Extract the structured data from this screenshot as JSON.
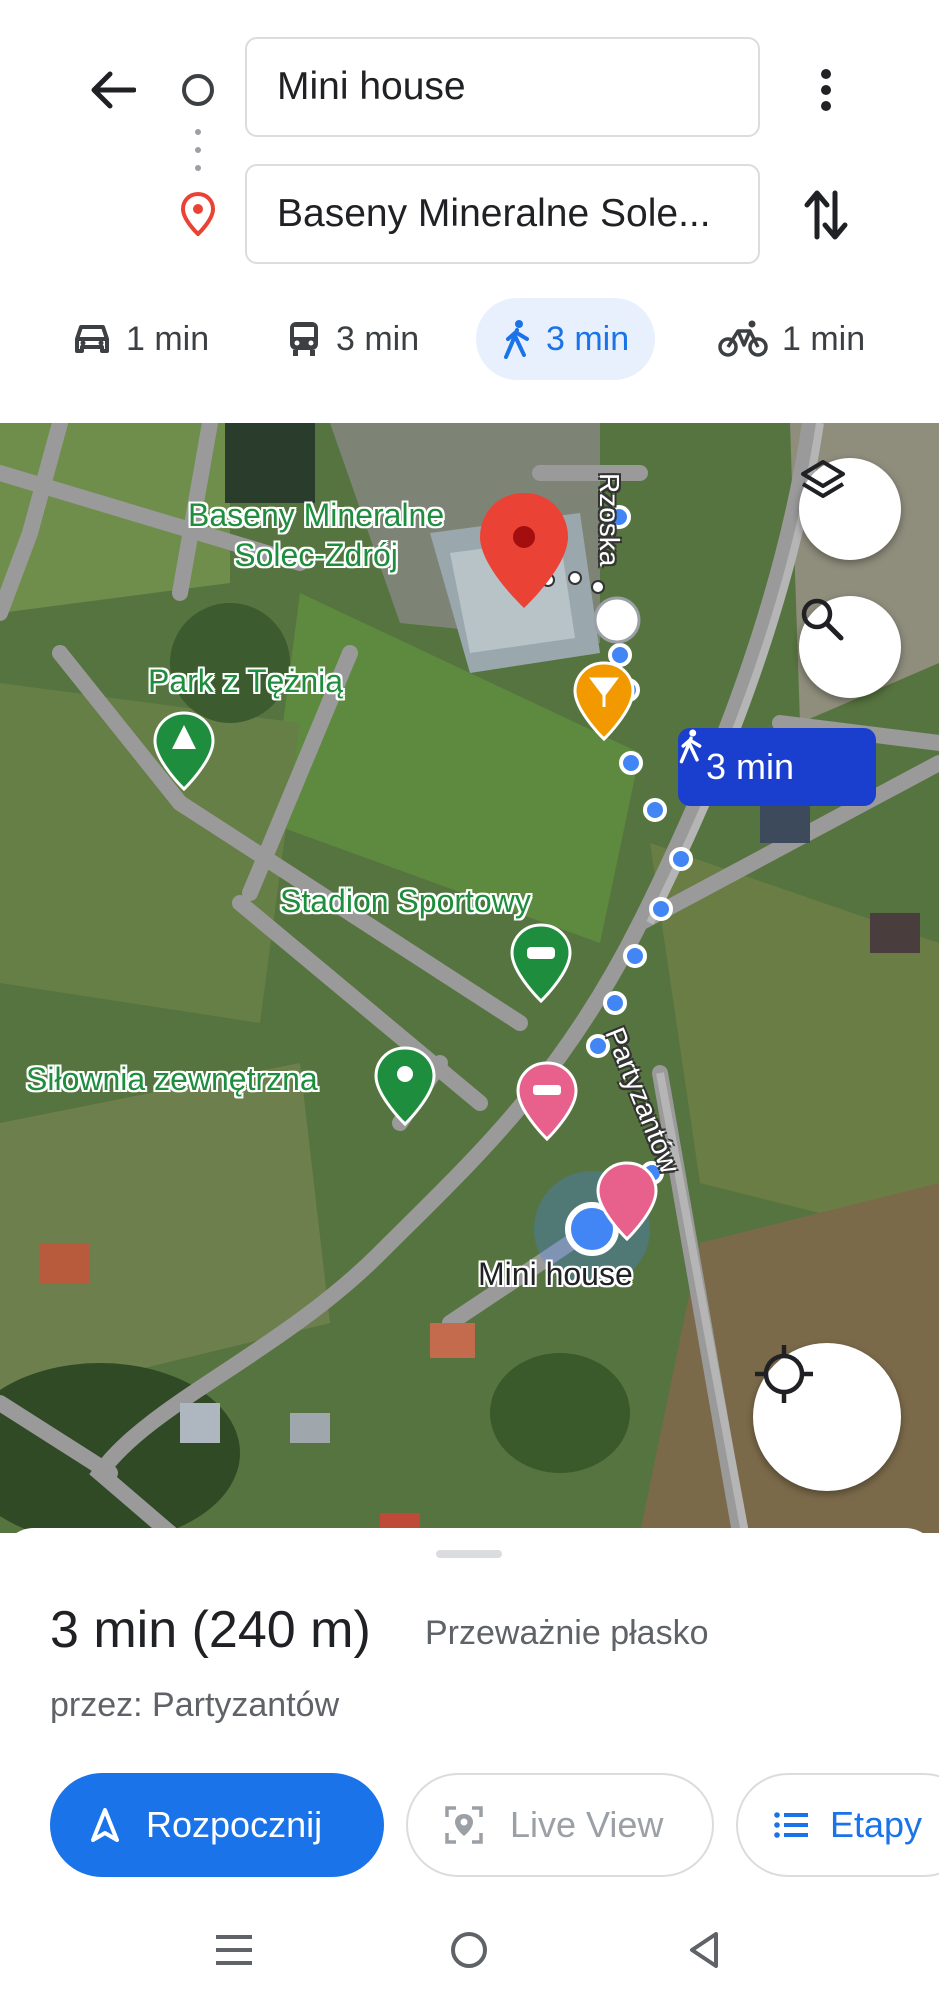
{
  "header": {
    "origin_value": "Mini house",
    "destination_value": "Baseny Mineralne Sole...",
    "icons": {
      "back": "back-arrow-icon",
      "origin": "origin-circle-icon",
      "destination": "destination-pin-icon",
      "menu": "more-vert-icon",
      "swap": "swap-icon"
    }
  },
  "modes": [
    {
      "icon": "car-icon",
      "label": "1 min"
    },
    {
      "icon": "transit-icon",
      "label": "3 min"
    },
    {
      "icon": "walk-icon",
      "label": "3 min",
      "active": true
    },
    {
      "icon": "bike-icon",
      "label": "1 min"
    }
  ],
  "map": {
    "labels": {
      "destination": "Baseny Mineralne\nSolec-Zdrój",
      "park": "Park z Tężnią",
      "stadium": "Stadion Sportowy",
      "gym": "Siłownia zewnętrzna",
      "origin": "Mini house"
    },
    "streets": {
      "rzoska": "Rzoska",
      "partyzantow": "Partyzantów"
    },
    "route_bubble": "3 min",
    "colors": {
      "route": "#1a73e8",
      "bubble": "#1a3fcf",
      "destination_pin": "#ea4335",
      "poi_green": "#1e8e3e",
      "poi_pink": "#e8618c",
      "poi_orange": "#f29900"
    }
  },
  "sheet": {
    "summary": "3 min (240 m)",
    "terrain": "Przeważnie płasko",
    "via": "przez: Partyzantów",
    "buttons": {
      "start": "Rozpocznij",
      "live_view": "Live View",
      "steps": "Etapy"
    }
  },
  "system_nav": {
    "icons": [
      "menu-lines-icon",
      "home-circle-icon",
      "back-triangle-icon"
    ]
  }
}
